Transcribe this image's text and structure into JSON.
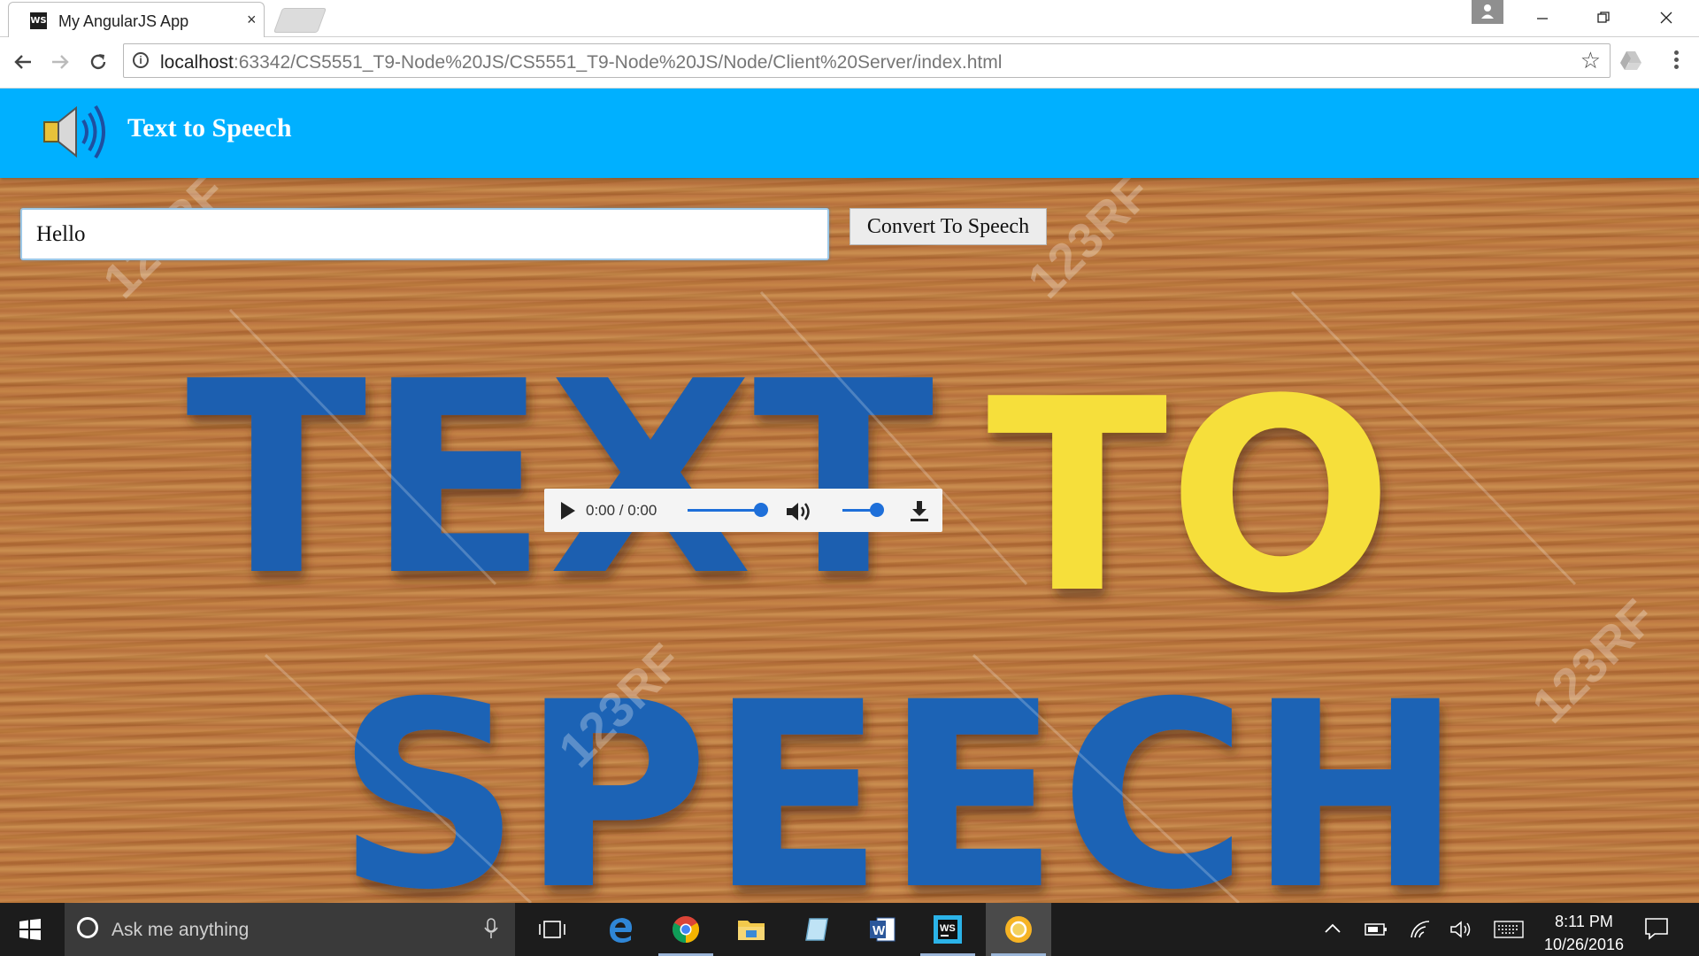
{
  "browser": {
    "tab_title": "My AngularJS App",
    "tab_favicon_text": "WS",
    "url_host": "localhost",
    "url_rest": ":63342/CS5551_T9-Node%20JS/CS5551_T9-Node%20JS/Node/Client%20Server/index.html",
    "info_symbol": "i",
    "star_symbol": "☆",
    "close_symbol": "×"
  },
  "app": {
    "title": "Text to Speech",
    "input_value": "Hello",
    "convert_label": "Convert To Speech",
    "header_color": "#00b0ff"
  },
  "audio": {
    "time": "0:00 / 0:00",
    "progress_level": 1.0,
    "volume_level": 1.0
  },
  "taskbar": {
    "search_placeholder": "Ask me anything",
    "time": "8:11 PM",
    "date": "10/26/2016",
    "apps": [
      "task-view",
      "edge",
      "chrome",
      "file-explorer",
      "paint",
      "word",
      "webstorm",
      "chrome-canary"
    ],
    "word_icon_text": "W",
    "webstorm_icon_text": "WS"
  },
  "background": {
    "line1": "TEXT",
    "line1b": "TO",
    "line2": "SPEECH",
    "watermark": "123RF"
  }
}
